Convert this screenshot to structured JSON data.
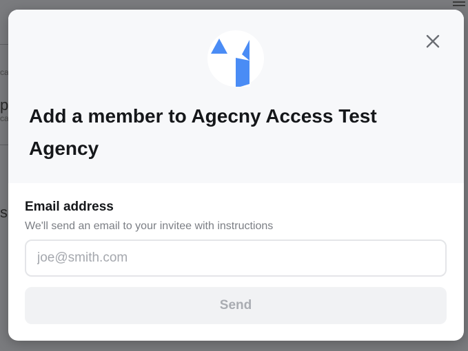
{
  "background": {
    "fragments": [
      "ca",
      "p",
      "ca",
      "s"
    ]
  },
  "modal": {
    "logo_icon": "agency-logo-icon",
    "close_icon": "close-icon",
    "title": "Add a member to Agecny Access Test Agency",
    "email": {
      "label": "Email address",
      "help": "We'll send an email to your invitee with instructions",
      "value": "",
      "placeholder": "joe@smith.com"
    },
    "send_label": "Send"
  },
  "colors": {
    "overlay": "#6f7073",
    "header_bg": "#f7f8fa",
    "logo_blue": "#4a8cf5",
    "title_text": "#15171a",
    "help_text": "#7b7e84",
    "disabled_button_bg": "#f1f2f4",
    "disabled_button_text": "#a9acb2"
  }
}
